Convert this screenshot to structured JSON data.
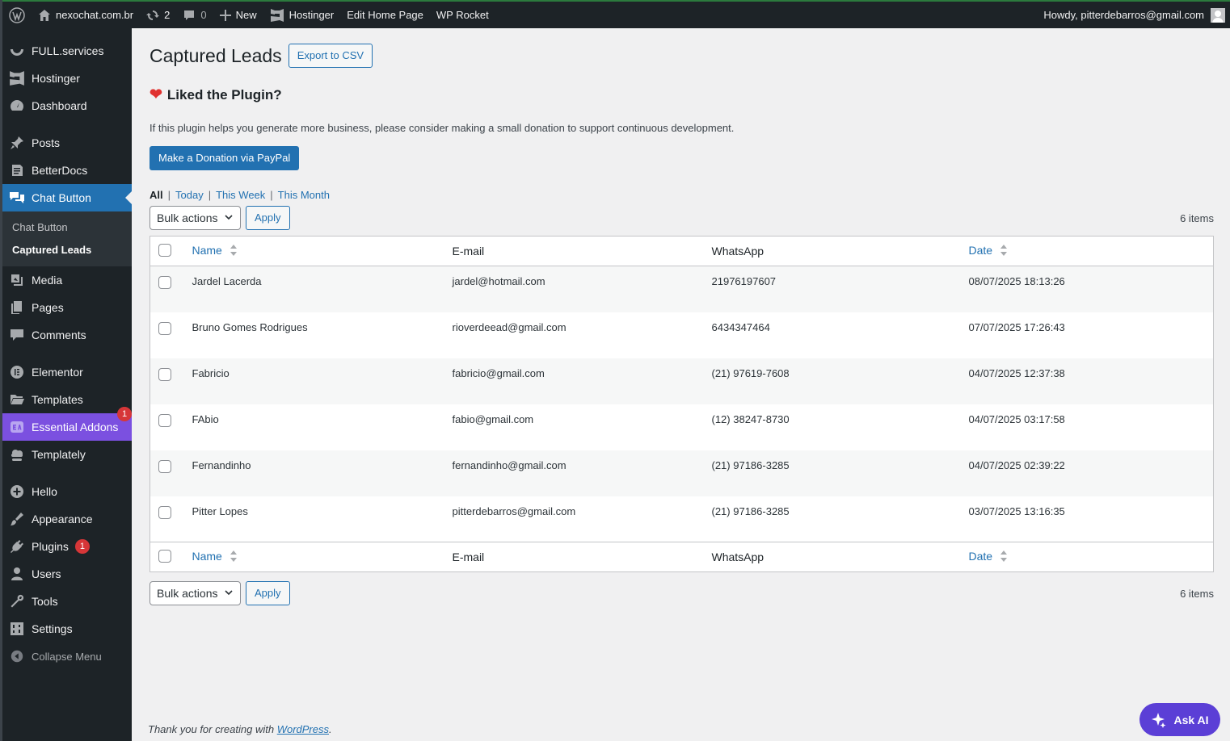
{
  "adminbar": {
    "site_name": "nexochat.com.br",
    "updates_count": "2",
    "comments_count": "0",
    "new_label": "New",
    "hostinger_label": "Hostinger",
    "edit_home_label": "Edit Home Page",
    "wp_rocket_label": "WP Rocket",
    "howdy": "Howdy, pitterdebarros@gmail.com"
  },
  "sidebar": {
    "items": [
      {
        "label": "FULL.services",
        "icon": "full-services-icon"
      },
      {
        "label": "Hostinger",
        "icon": "hostinger-icon"
      },
      {
        "label": "Dashboard",
        "icon": "dashboard-icon"
      },
      {
        "label": "Posts",
        "icon": "pin-icon"
      },
      {
        "label": "BetterDocs",
        "icon": "docs-icon"
      },
      {
        "label": "Chat Button",
        "icon": "chat-icon"
      },
      {
        "label": "Media",
        "icon": "media-icon"
      },
      {
        "label": "Pages",
        "icon": "pages-icon"
      },
      {
        "label": "Comments",
        "icon": "comment-icon"
      },
      {
        "label": "Elementor",
        "icon": "elementor-icon"
      },
      {
        "label": "Templates",
        "icon": "folder-icon"
      },
      {
        "label": "Essential Addons",
        "icon": "essential-addons-icon",
        "badge": "1"
      },
      {
        "label": "Templately",
        "icon": "templately-icon"
      },
      {
        "label": "Hello",
        "icon": "plus-circle-icon"
      },
      {
        "label": "Appearance",
        "icon": "brush-icon"
      },
      {
        "label": "Plugins",
        "icon": "plug-icon",
        "badge": "1"
      },
      {
        "label": "Users",
        "icon": "user-icon"
      },
      {
        "label": "Tools",
        "icon": "wrench-icon"
      },
      {
        "label": "Settings",
        "icon": "settings-icon"
      }
    ],
    "submenu": [
      "Chat Button",
      "Captured Leads"
    ],
    "collapse_label": "Collapse Menu"
  },
  "main": {
    "title": "Captured Leads",
    "export_label": "Export to CSV",
    "liked_title": "Liked the Plugin?",
    "donate_text": "If this plugin helps you generate more business, please consider making a small donation to support continuous development.",
    "donate_button": "Make a Donation via PayPal",
    "filters": [
      "All",
      "Today",
      "This Week",
      "This Month"
    ],
    "bulk_actions": "Bulk actions",
    "apply_label": "Apply",
    "items_count": "6 items",
    "columns": [
      "Name",
      "E-mail",
      "WhatsApp",
      "Date"
    ],
    "rows": [
      {
        "name": "Jardel Lacerda",
        "email": "jardel@hotmail.com",
        "whatsapp": "21976197607",
        "date": "08/07/2025 18:13:26"
      },
      {
        "name": "Bruno Gomes Rodrigues",
        "email": "rioverdeead@gmail.com",
        "whatsapp": "6434347464",
        "date": "07/07/2025 17:26:43"
      },
      {
        "name": "Fabricio",
        "email": "fabricio@gmail.com",
        "whatsapp": "(21) 97619-7608",
        "date": "04/07/2025 12:37:38"
      },
      {
        "name": "FAbio",
        "email": "fabio@gmail.com",
        "whatsapp": "(12) 38247-8730",
        "date": "04/07/2025 03:17:58"
      },
      {
        "name": "Fernandinho",
        "email": "fernandinho@gmail.com",
        "whatsapp": "(21) 97186-3285",
        "date": "04/07/2025 02:39:22"
      },
      {
        "name": "Pitter Lopes",
        "email": "pitterdebarros@gmail.com",
        "whatsapp": "(21) 97186-3285",
        "date": "03/07/2025 13:16:35"
      }
    ]
  },
  "footer": {
    "text_before": "Thank you for creating with ",
    "link": "WordPress",
    "text_after": "."
  },
  "ask_ai": "Ask AI"
}
